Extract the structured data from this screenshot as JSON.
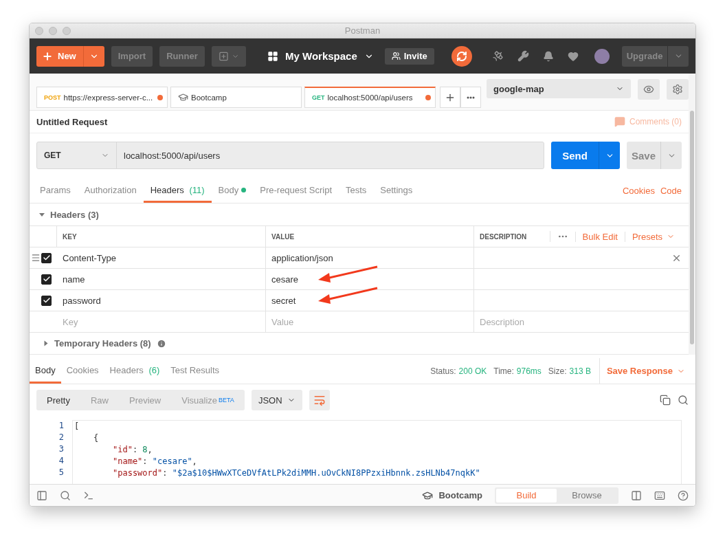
{
  "window": {
    "title": "Postman"
  },
  "toolbar": {
    "new_button": "New",
    "import_button": "Import",
    "runner_button": "Runner",
    "workspace": "My Workspace",
    "invite_button": "Invite",
    "upgrade_button": "Upgrade"
  },
  "request_tabs": [
    {
      "method": "POST",
      "label": "https://express-server-c...",
      "unsaved": true,
      "selected": false,
      "kind": "request"
    },
    {
      "label": "Bootcamp",
      "unsaved": false,
      "selected": false,
      "kind": "collection"
    },
    {
      "method": "GET",
      "label": "localhost:5000/api/users",
      "unsaved": true,
      "selected": true,
      "kind": "request"
    }
  ],
  "environment": {
    "value": "google-map"
  },
  "request": {
    "title": "Untitled Request",
    "comments": "Comments (0)",
    "method": "GET",
    "url": "localhost:5000/api/users",
    "send_button": "Send",
    "save_button": "Save"
  },
  "request_sections": [
    {
      "label": "Params",
      "selected": false
    },
    {
      "label": "Authorization",
      "selected": false
    },
    {
      "label": "Headers",
      "count": "(11)",
      "selected": true
    },
    {
      "label": "Body",
      "dot": true,
      "selected": false
    },
    {
      "label": "Pre-request Script",
      "selected": false
    },
    {
      "label": "Tests",
      "selected": false
    },
    {
      "label": "Settings",
      "selected": false
    }
  ],
  "request_links": [
    "Cookies",
    "Code"
  ],
  "headers": {
    "title": "Headers (3)",
    "expanded": true,
    "columns": [
      "KEY",
      "VALUE",
      "DESCRIPTION"
    ],
    "bulk_edit": "Bulk Edit",
    "presets": "Presets",
    "rows": [
      {
        "key": "Content-Type",
        "value": "application/json",
        "checked": true,
        "arrow": false
      },
      {
        "key": "name",
        "value": "cesare",
        "checked": true,
        "arrow": true
      },
      {
        "key": "password",
        "value": "secret",
        "checked": true,
        "arrow": true
      }
    ],
    "new_row": {
      "key_placeholder": "Key",
      "value_placeholder": "Value",
      "description_placeholder": "Description"
    }
  },
  "temporary_headers": {
    "title": "Temporary Headers (8)",
    "expanded": false
  },
  "response": {
    "tabs": [
      {
        "label": "Body",
        "selected": true
      },
      {
        "label": "Cookies",
        "selected": false
      },
      {
        "label": "Headers",
        "count": "(6)",
        "selected": false
      },
      {
        "label": "Test Results",
        "selected": false
      }
    ],
    "status_label": "Status:",
    "status": "200 OK",
    "time_label": "Time:",
    "time": "976ms",
    "size_label": "Size:",
    "size": "313 B",
    "save_response": "Save Response",
    "views": [
      {
        "label": "Pretty",
        "selected": true
      },
      {
        "label": "Raw",
        "selected": false
      },
      {
        "label": "Preview",
        "selected": false
      },
      {
        "label": "Visualize",
        "badge": "BETA",
        "selected": false
      }
    ],
    "format": "JSON",
    "code_lines": [
      {
        "number": "1",
        "kind": "root",
        "tokens": [
          {
            "kind": "punct",
            "text": "["
          }
        ]
      },
      {
        "number": "2",
        "kind": "object",
        "tokens": [
          {
            "kind": "punct",
            "text": "{"
          }
        ]
      },
      {
        "number": "3",
        "kind": "member",
        "tokens": [
          {
            "kind": "key",
            "text": "\"id\""
          },
          {
            "kind": "punct",
            "text": ": "
          },
          {
            "kind": "number",
            "text": "8"
          },
          {
            "kind": "punct",
            "text": ","
          }
        ]
      },
      {
        "number": "4",
        "kind": "member",
        "tokens": [
          {
            "kind": "key",
            "text": "\"name\""
          },
          {
            "kind": "punct",
            "text": ": "
          },
          {
            "kind": "string",
            "text": "\"cesare\""
          },
          {
            "kind": "punct",
            "text": ","
          }
        ]
      },
      {
        "number": "5",
        "kind": "member",
        "tokens": [
          {
            "kind": "key",
            "text": "\"password\""
          },
          {
            "kind": "punct",
            "text": ": "
          },
          {
            "kind": "string",
            "text": "\"$2a$10$HWwXTCeDVfAtLPk2diMMH.uOvCkNI8PPzxiHbnnk.zsHLNb47nqkK\""
          }
        ]
      }
    ]
  },
  "status_bar": {
    "collection": "Bootcamp",
    "modes": [
      {
        "label": "Build",
        "selected": true
      },
      {
        "label": "Browse",
        "selected": false
      }
    ]
  }
}
